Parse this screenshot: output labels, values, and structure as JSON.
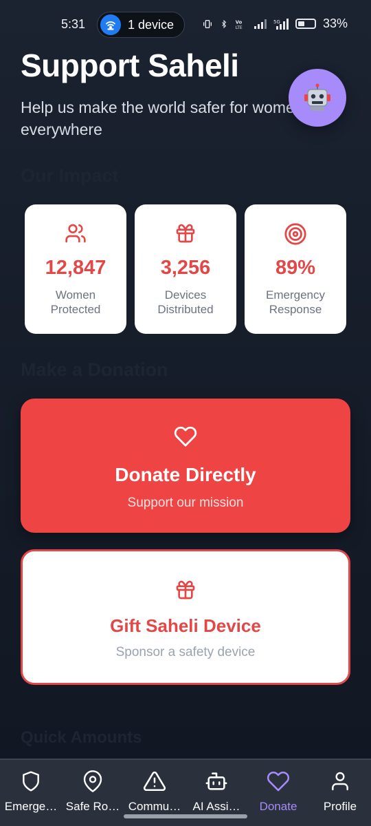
{
  "status_bar": {
    "time": "5:31",
    "hotspot_label": "1 device",
    "battery_percent": "33%",
    "battery_level": 0.33,
    "icons": [
      "vibrate-icon",
      "bluetooth-icon",
      "volte-icon",
      "signal-icon",
      "5g-signal-icon",
      "battery-icon"
    ]
  },
  "header": {
    "title": "Support Saheli",
    "subtitle": "Help us make the world safer for women everywhere"
  },
  "assistant_fab": {
    "icon": "robot-icon",
    "color": "#a78bfa"
  },
  "sections": {
    "impact": "Our Impact",
    "donation": "Make a Donation",
    "quick_amounts": "Quick Amounts"
  },
  "stats": [
    {
      "icon": "users-icon",
      "value": "12,847",
      "label": "Women Protected"
    },
    {
      "icon": "gift-icon",
      "value": "3,256",
      "label": "Devices Distributed"
    },
    {
      "icon": "target-icon",
      "value": "89%",
      "label": "Emergency Response"
    }
  ],
  "donate_card": {
    "icon": "heart-icon",
    "title": "Donate Directly",
    "subtitle": "Support our mission",
    "color": "#ef4444"
  },
  "gift_card": {
    "icon": "gift-icon",
    "title": "Gift Saheli Device",
    "subtitle": "Sponsor a safety device"
  },
  "nav": [
    {
      "icon": "shield-icon",
      "label": "Emerge…",
      "active": false
    },
    {
      "icon": "map-pin-icon",
      "label": "Safe Ro…",
      "active": false
    },
    {
      "icon": "alert-triangle-icon",
      "label": "Commu…",
      "active": false
    },
    {
      "icon": "bot-icon",
      "label": "AI Assi…",
      "active": false
    },
    {
      "icon": "heart-icon",
      "label": "Donate",
      "active": true
    },
    {
      "icon": "user-icon",
      "label": "Profile",
      "active": false
    }
  ],
  "colors": {
    "accent": "#e24848",
    "active_nav": "#a78bfa",
    "background": "#161d29"
  }
}
